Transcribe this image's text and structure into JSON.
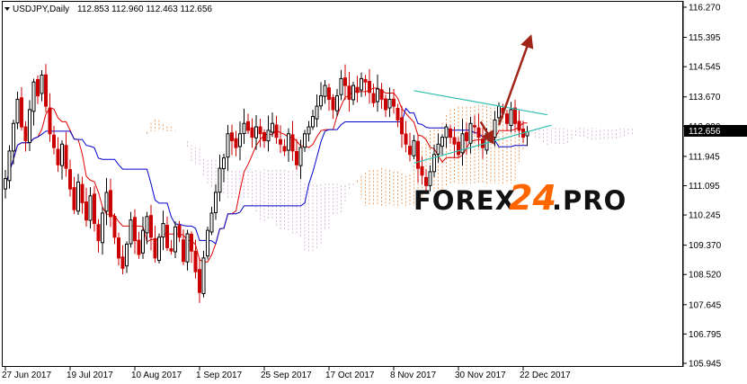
{
  "header": {
    "symbol": "USDJPY,Daily",
    "ohlc": "112.853 112.960 112.463 112.656"
  },
  "watermark": {
    "part1": "FOREX",
    "part2": "24",
    "part3": ".PRO"
  },
  "colors": {
    "background": "#ffffff",
    "bull_candle": "#000000",
    "bear_candle": "#cc0000",
    "tenkan": "#e00000",
    "kijun": "#0000cc",
    "kumo_bull": "#f0a060",
    "kumo_bear": "#d8b8d8",
    "trendline": "#30c0b0",
    "arrow": "#a02418",
    "price_label_bg": "#000000",
    "watermark_dark": "#111111",
    "watermark_accent": "#ff6600"
  },
  "chart_data": {
    "type": "candlestick",
    "indicator": "Ichimoku",
    "ylim": [
      105.945,
      116.27
    ],
    "y_ticks": [
      "116.270",
      "115.395",
      "114.545",
      "113.670",
      "112.820",
      "111.945",
      "111.095",
      "110.245",
      "109.370",
      "108.520",
      "107.645",
      "106.795",
      "105.945"
    ],
    "x_ticks": [
      "27 Jun 2017",
      "19 Jul 2017",
      "10 Aug 2017",
      "1 Sep 2017",
      "25 Sep 2017",
      "17 Oct 2017",
      "8 Nov 2017",
      "30 Nov 2017",
      "22 Dec 2017"
    ],
    "current_price": "112.656",
    "x_tick_bar_index": [
      0,
      16,
      32,
      48,
      64,
      80,
      96,
      112,
      128
    ],
    "closes": [
      111.3,
      112.1,
      112.9,
      113.6,
      112.8,
      112.4,
      113.3,
      114.1,
      113.7,
      114.3,
      113.4,
      112.6,
      112.2,
      111.7,
      112.3,
      111.6,
      111.0,
      110.4,
      111.2,
      110.6,
      110.1,
      110.8,
      110.0,
      109.5,
      110.3,
      110.9,
      110.2,
      109.6,
      109.0,
      108.7,
      109.4,
      110.1,
      109.5,
      109.1,
      109.8,
      110.2,
      109.6,
      109.0,
      109.6,
      110.0,
      109.3,
      109.2,
      109.9,
      109.6,
      108.9,
      109.7,
      109.2,
      108.6,
      108.0,
      109.0,
      109.8,
      110.3,
      110.9,
      111.6,
      111.9,
      112.6,
      112.4,
      112.2,
      112.6,
      112.9,
      112.7,
      112.5,
      112.8,
      112.6,
      112.4,
      112.7,
      112.9,
      112.5,
      112.3,
      112.1,
      112.6,
      112.1,
      111.7,
      112.2,
      112.6,
      112.8,
      113.1,
      113.4,
      113.7,
      114.0,
      113.6,
      113.3,
      113.7,
      114.2,
      114.0,
      113.6,
      114.0,
      113.8,
      114.2,
      114.1,
      113.8,
      113.5,
      113.9,
      113.6,
      113.3,
      113.6,
      113.4,
      113.0,
      112.6,
      112.3,
      112.0,
      112.4,
      111.6,
      111.4,
      111.1,
      111.5,
      112.0,
      112.3,
      112.5,
      112.8,
      112.5,
      112.3,
      112.0,
      112.6,
      112.4,
      112.9,
      112.8,
      112.5,
      112.2,
      112.6,
      112.5,
      113.0,
      113.4,
      113.2,
      112.9,
      113.3,
      112.9,
      112.7,
      112.5,
      112.656
    ],
    "annotations": [
      "symmetrical triangle",
      "breakout arrow"
    ]
  }
}
